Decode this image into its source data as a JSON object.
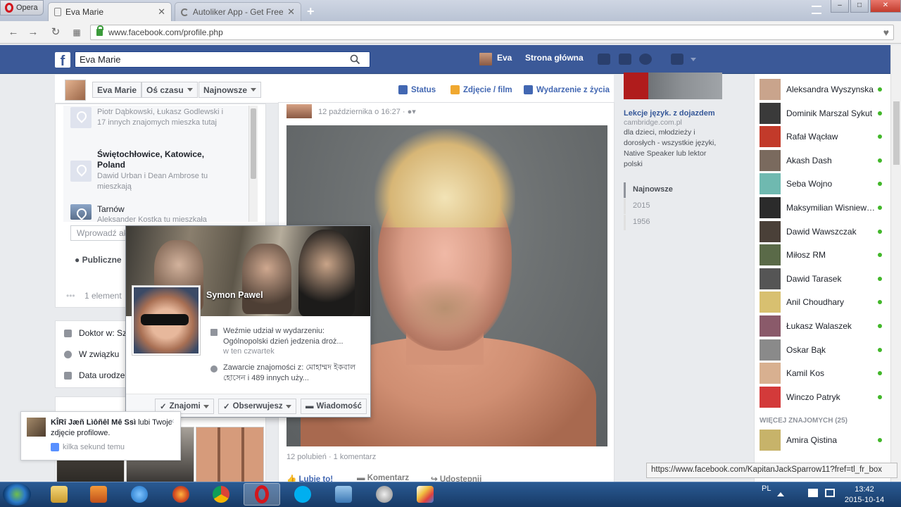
{
  "browser": {
    "opera_label": "Opera",
    "tabs": [
      {
        "label": "Eva Marie",
        "active": true
      },
      {
        "label": "Autoliker App - Get Free ...",
        "active": false
      }
    ],
    "new_tab": "+",
    "url": "www.facebook.com/profile.php"
  },
  "fb_header": {
    "logo": "f",
    "search_value": "Eva Marie",
    "user_name": "Eva",
    "home_label": "Strona główna"
  },
  "timeline_header": {
    "name_btn": "Eva Marie",
    "timeline_btn": "Oś czasu",
    "newest_btn": "Najnowsze",
    "actions": [
      "Status",
      "Zdjęcie / film",
      "Wydarzenie z życia"
    ]
  },
  "places": [
    {
      "title": "",
      "sub": "Piotr Dąbkowski, Łukasz Godlewski i 17 innych znajomych mieszka tutaj"
    },
    {
      "title": "Świętochłowice, Katowice, Poland",
      "sub": "Dawid Urban i Dean Ambrose tu mieszkają"
    },
    {
      "title": "Tarnów",
      "sub": "Aleksander Kostka tu mieszkała"
    }
  ],
  "place_input_placeholder": "Wprowadź ak",
  "privacy_label": "Publiczne",
  "elements_label": "1 element",
  "about": [
    {
      "label": "Doktor w: Szp"
    },
    {
      "label": "W związku"
    },
    {
      "label": "Data urodzen"
    }
  ],
  "hovercard": {
    "name": "Symon Pawel",
    "event_line": "Weźmie udział w wydarzeniu: Ogólnopolski dzień jedzenia droż...",
    "event_when": "w ten czwartek",
    "mutual_line": "Zawarcie znajomości z: মোহাম্মদ ইকবাল হোসেন i 489 innych uży...",
    "btn_friends": "Znajomi",
    "btn_follow": "Obserwujesz",
    "btn_message": "Wiadomość"
  },
  "notification": {
    "actor": "KÎRî Jæñ Lìôñêl Mê Ssì",
    "text": " lubi Twoje zdjęcie profilowe.",
    "time": "kilka sekund temu",
    "close": "×"
  },
  "post": {
    "date": "12 października o 16:27 · ",
    "stats": "12 polubień · 1 komentarz",
    "actions": [
      "Lubię to!",
      "Komentarz",
      "Udostępnij"
    ]
  },
  "ad": {
    "title": "Lekcje język. z dojazdem",
    "url": "cambridge.com.pl",
    "body": "dla dzieci, młodzieży i dorosłych - wszystkie języki, Native Speaker lub lektor polski"
  },
  "years": [
    "Najnowsze",
    "2015",
    "1956"
  ],
  "friends": [
    {
      "name": "Aleksandra Wyszynska",
      "color": "#c9a48c"
    },
    {
      "name": "Dominik Marszal Sykut",
      "color": "#3a3a3a"
    },
    {
      "name": "Rafał Wącław",
      "color": "#c23a2a"
    },
    {
      "name": "Akash Dash",
      "color": "#7a6a5e"
    },
    {
      "name": "Seba Wojno",
      "color": "#6fb9b0"
    },
    {
      "name": "Maksymilian Wisniewski",
      "color": "#2b2b2b"
    },
    {
      "name": "Dawid Wawszczak",
      "color": "#4a4038"
    },
    {
      "name": "Miłosz RM",
      "color": "#5a6a48"
    },
    {
      "name": "Dawid Tarasek",
      "color": "#555555"
    },
    {
      "name": "Anil Choudhary",
      "color": "#d8c070"
    },
    {
      "name": "Łukasz Walaszek",
      "color": "#8a5a6a"
    },
    {
      "name": "Oskar Bąk",
      "color": "#8a8a8a"
    },
    {
      "name": "Kamil Kos",
      "color": "#d8b090"
    },
    {
      "name": "Winczo Patryk",
      "color": "#d33a3a"
    }
  ],
  "more_friends": "WIĘCEJ ZNAJOMYCH (25)",
  "more_friends_list": [
    {
      "name": "Amira Qistina",
      "color": "#c7b36a"
    }
  ],
  "status_url": "https://www.facebook.com/KapitanJackSparrow11?fref=tl_fr_box",
  "taskbar": {
    "lang": "PL",
    "time": "13:42",
    "date": "2015-10-14"
  }
}
